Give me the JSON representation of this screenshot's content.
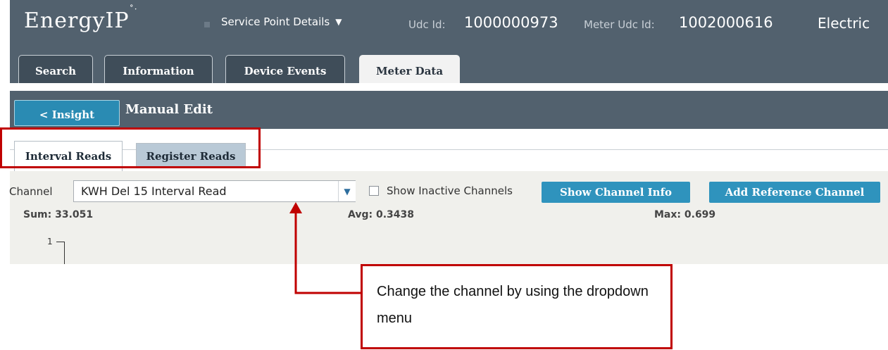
{
  "header": {
    "logo": "EnergyIP",
    "logo_mark": "˚·",
    "service_point_menu": "Service Point Details",
    "udc_label": "Udc Id:",
    "udc_value": "1000000973",
    "meter_label": "Meter Udc Id:",
    "meter_value": "1002000616",
    "commodity": "Electric",
    "tabs": [
      {
        "label": "Search",
        "active": false
      },
      {
        "label": "Information",
        "active": false
      },
      {
        "label": "Device Events",
        "active": false
      },
      {
        "label": "Meter Data",
        "active": true
      }
    ]
  },
  "subheader": {
    "back_button": "< Insight",
    "page_title": "Manual Edit"
  },
  "read_tabs": [
    {
      "label": "Interval Reads",
      "active": true
    },
    {
      "label": "Register Reads",
      "active": false
    }
  ],
  "channel": {
    "label": "Channel",
    "selected": "KWH Del 15 Interval Read",
    "show_inactive_label": "Show Inactive Channels",
    "show_inactive_checked": false,
    "show_channel_info": "Show Channel Info",
    "add_reference_channel": "Add Reference Channel"
  },
  "stats": {
    "sum": "Sum: 33.051",
    "avg": "Avg: 0.3438",
    "max": "Max: 0.699"
  },
  "chart_axis_top": "1",
  "annotation": {
    "text": "Change the channel by using the dropdown menu",
    "color": "#c00000"
  },
  "colors": {
    "header_bg": "#52616e",
    "button_blue": "#2f93bd",
    "highlight_red": "#c00000"
  }
}
